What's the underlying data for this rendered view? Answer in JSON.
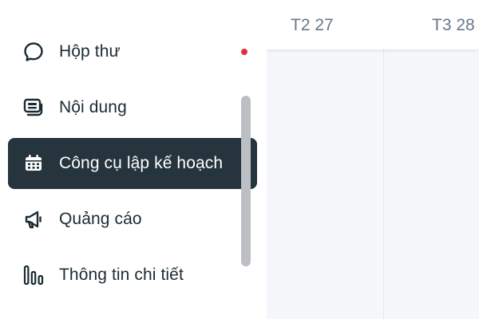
{
  "sidebar": {
    "items": [
      {
        "label": "Hộp thư",
        "icon": "chat-bubble-icon",
        "active": false,
        "has_notification": true
      },
      {
        "label": "Nội dung",
        "icon": "content-icon",
        "active": false,
        "has_notification": false
      },
      {
        "label": "Công cụ lập kế hoạch",
        "icon": "calendar-icon",
        "active": true,
        "has_notification": false
      },
      {
        "label": "Quảng cáo",
        "icon": "megaphone-icon",
        "active": false,
        "has_notification": false
      },
      {
        "label": "Thông tin chi tiết",
        "icon": "insights-bars-icon",
        "active": false,
        "has_notification": false
      }
    ]
  },
  "calendar": {
    "days": [
      "T2 27",
      "T3 28"
    ]
  },
  "colors": {
    "active_bg": "#25343d",
    "text": "#1c2b33",
    "notification": "#e0303d",
    "header_text": "#67788a",
    "calendar_bg": "#f5f7fb"
  }
}
